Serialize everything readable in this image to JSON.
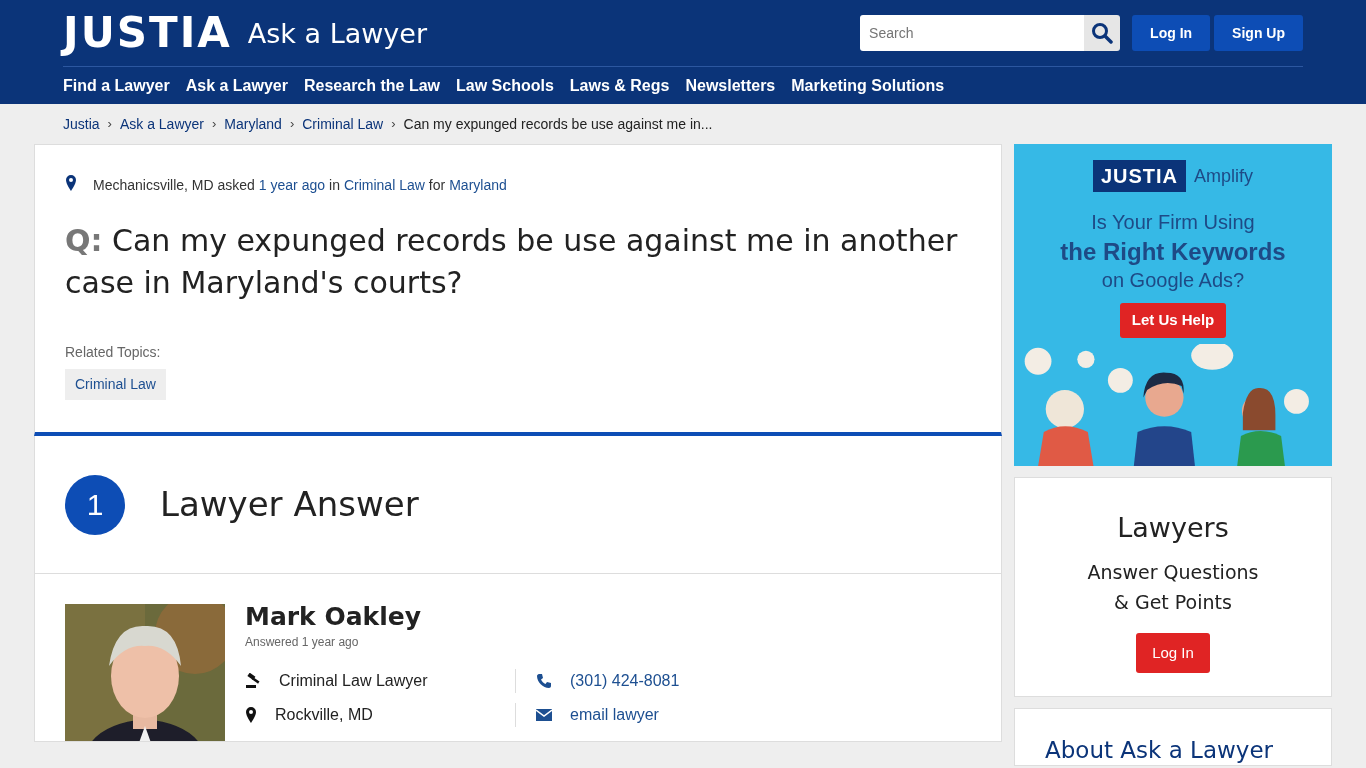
{
  "header": {
    "logo": "JUSTIA",
    "subtitle": "Ask a Lawyer",
    "search": {
      "placeholder": "Search"
    },
    "buttons": [
      "Log In",
      "Sign Up"
    ],
    "nav": [
      "Find a Lawyer",
      "Ask a Lawyer",
      "Research the Law",
      "Law Schools",
      "Laws & Regs",
      "Newsletters",
      "Marketing Solutions"
    ]
  },
  "breadcrumb": [
    {
      "kind": "link",
      "text": "Justia"
    },
    {
      "kind": "separator",
      "text": "›"
    },
    {
      "kind": "link",
      "text": "Ask a Lawyer"
    },
    {
      "kind": "separator",
      "text": "›"
    },
    {
      "kind": "link",
      "text": "Maryland"
    },
    {
      "kind": "separator",
      "text": "›"
    },
    {
      "kind": "link",
      "text": "Criminal Law"
    },
    {
      "kind": "separator",
      "text": "›"
    },
    {
      "kind": "current",
      "text": "Can my expunged records be use against me in..."
    }
  ],
  "question": {
    "meta": [
      {
        "kind": "text",
        "text": "Mechanicsville, MD asked"
      },
      {
        "kind": "link",
        "text": "1 year ago"
      },
      {
        "kind": "text",
        "text": "in"
      },
      {
        "kind": "link",
        "text": "Criminal Law"
      },
      {
        "kind": "text",
        "text": "for"
      },
      {
        "kind": "link",
        "text": "Maryland"
      }
    ],
    "prefix": "Q:",
    "text": "Can my expunged records be use against me in another case in Maryland's courts?",
    "related_label": "Related Topics:",
    "topics": [
      "Criminal Law"
    ]
  },
  "answers": {
    "count": "1",
    "heading": "Lawyer Answer"
  },
  "lawyer": {
    "name": "Mark Oakley",
    "answered": "Answered 1 year ago",
    "details": [
      {
        "kind": "gavel",
        "text": "Criminal Law Lawyer",
        "link": false
      },
      {
        "kind": "phone",
        "text": "(301) 424-8081",
        "link": true
      },
      {
        "kind": "pin",
        "text": "Rockville, MD",
        "link": false
      },
      {
        "kind": "mail",
        "text": "email lawyer",
        "link": true
      }
    ]
  },
  "ad": {
    "brand": "JUSTIA",
    "product": "Amplify",
    "lines": [
      "Is Your Firm Using",
      "the Right Keywords",
      "on Google Ads?"
    ],
    "button": "Let Us Help"
  },
  "lawyers_card": {
    "title": "Lawyers",
    "lines": [
      "Answer Questions",
      "& Get Points"
    ],
    "button": "Log In"
  },
  "about": {
    "title": "About Ask a Lawyer"
  }
}
